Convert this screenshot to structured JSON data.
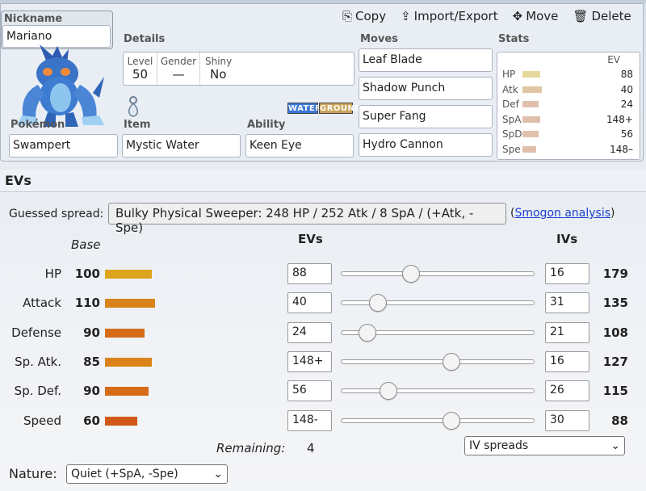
{
  "nickname": {
    "label": "Nickname",
    "value": "Mariano"
  },
  "actions": [
    {
      "name": "copy",
      "icon": "⎘",
      "label": "Copy"
    },
    {
      "name": "import-export",
      "icon": "⇪",
      "label": "Import/Export"
    },
    {
      "name": "move",
      "icon": "✥",
      "label": "Move"
    },
    {
      "name": "delete",
      "icon": "🗑",
      "label": "Delete"
    }
  ],
  "details": {
    "label": "Details",
    "level_label": "Level",
    "level": "50",
    "gender_label": "Gender",
    "gender": "—",
    "shiny_label": "Shiny",
    "shiny": "No"
  },
  "types": [
    {
      "name": "WATER",
      "color": "#3b78d6"
    },
    {
      "name": "GROUND",
      "color": "#c9a35a"
    }
  ],
  "pokemon": {
    "label": "Pokémon",
    "value": "Swampert"
  },
  "item": {
    "label": "Item",
    "value": "Mystic Water"
  },
  "ability": {
    "label": "Ability",
    "value": "Keen Eye"
  },
  "moves": {
    "label": "Moves",
    "list": [
      "Leaf Blade",
      "Shadow Punch",
      "Super Fang",
      "Hydro Cannon"
    ]
  },
  "stats_panel": {
    "label": "Stats",
    "ev_header": "EV",
    "rows": [
      {
        "name": "HP",
        "ev": "88",
        "bar_fraction": 0.62,
        "color": "#e5d79d"
      },
      {
        "name": "Atk",
        "ev": "40",
        "bar_fraction": 0.66,
        "color": "#e0c6a4"
      },
      {
        "name": "Def",
        "ev": "24",
        "bar_fraction": 0.55,
        "color": "#e0c0ad"
      },
      {
        "name": "SpA",
        "ev": "148+",
        "bar_fraction": 0.62,
        "color": "#e0c0ad"
      },
      {
        "name": "SpD",
        "ev": "56",
        "bar_fraction": 0.55,
        "color": "#e0c0ad"
      },
      {
        "name": "Spe",
        "ev": "148–",
        "bar_fraction": 0.47,
        "color": "#e0c0ad"
      }
    ]
  },
  "evs_section": {
    "title": "EVs",
    "guessed_label": "Guessed spread:",
    "guessed_value": "Bulky Physical Sweeper: 248 HP / 252 Atk / 8 SpA / (+Atk, -Spe)",
    "smogon_open": "(",
    "smogon_link": "Smogon analysis",
    "smogon_close": ")",
    "base_header": "Base",
    "evs_header": "EVs",
    "ivs_header": "IVs",
    "rows": [
      {
        "stat": "HP",
        "base": "100",
        "base_fraction": 0.58,
        "base_color": "#dba41c",
        "ev": "88",
        "ev_fraction": 0.35,
        "iv": "16",
        "total": "179"
      },
      {
        "stat": "Attack",
        "base": "110",
        "base_fraction": 0.62,
        "base_color": "#d9831a",
        "ev": "40",
        "ev_fraction": 0.16,
        "iv": "31",
        "total": "135"
      },
      {
        "stat": "Defense",
        "base": "90",
        "base_fraction": 0.49,
        "base_color": "#d66b18",
        "ev": "24",
        "ev_fraction": 0.1,
        "iv": "21",
        "total": "108"
      },
      {
        "stat": "Sp. Atk.",
        "base": "85",
        "base_fraction": 0.58,
        "base_color": "#d9831a",
        "ev": "148+",
        "ev_fraction": 0.58,
        "iv": "16",
        "total": "127"
      },
      {
        "stat": "Sp. Def.",
        "base": "90",
        "base_fraction": 0.54,
        "base_color": "#d66b18",
        "ev": "56",
        "ev_fraction": 0.22,
        "iv": "26",
        "total": "115"
      },
      {
        "stat": "Speed",
        "base": "60",
        "base_fraction": 0.4,
        "base_color": "#d05818",
        "ev": "148-",
        "ev_fraction": 0.58,
        "iv": "30",
        "total": "88"
      }
    ],
    "remaining_label": "Remaining:",
    "remaining_value": "4",
    "iv_spreads": "IV spreads",
    "nature_label": "Nature:",
    "nature_value": "Quiet (+SpA, -Spe)"
  }
}
